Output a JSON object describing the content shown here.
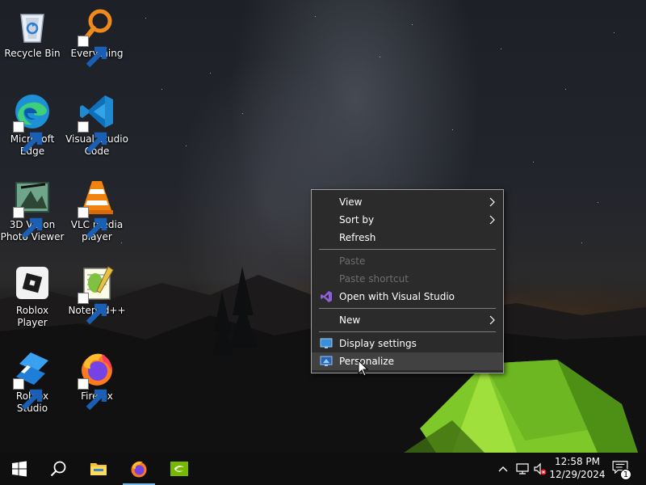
{
  "desktop": {
    "icons": [
      {
        "label": "Recycle Bin",
        "icon": "recycle-bin-icon"
      },
      {
        "label": "Everything",
        "icon": "everything-search-icon"
      },
      {
        "label": "Microsoft Edge",
        "icon": "edge-icon"
      },
      {
        "label": "Visual Studio Code",
        "icon": "vscode-icon"
      },
      {
        "label": "3D Vision Photo Viewer",
        "icon": "3d-vision-icon"
      },
      {
        "label": "VLC media player",
        "icon": "vlc-icon"
      },
      {
        "label": "Roblox Player",
        "icon": "roblox-player-icon"
      },
      {
        "label": "Notepad++",
        "icon": "notepad-plus-plus-icon"
      },
      {
        "label": "Roblox Studio",
        "icon": "roblox-studio-icon"
      },
      {
        "label": "Firefox",
        "icon": "firefox-icon"
      }
    ]
  },
  "context_menu": {
    "items": [
      {
        "label": "View",
        "submenu": true,
        "enabled": true
      },
      {
        "label": "Sort by",
        "submenu": true,
        "enabled": true
      },
      {
        "label": "Refresh",
        "enabled": true
      },
      {
        "label": "Paste",
        "enabled": false
      },
      {
        "label": "Paste shortcut",
        "enabled": false
      },
      {
        "label": "Open with Visual Studio",
        "enabled": true,
        "icon": "visual-studio-icon"
      },
      {
        "label": "New",
        "submenu": true,
        "enabled": true
      },
      {
        "label": "Display settings",
        "enabled": true,
        "icon": "display-settings-icon"
      },
      {
        "label": "Personalize",
        "enabled": true,
        "icon": "personalize-icon",
        "hovered": true
      }
    ]
  },
  "taskbar": {
    "buttons": [
      {
        "name": "start",
        "icon": "windows-logo-icon"
      },
      {
        "name": "search",
        "icon": "search-icon"
      },
      {
        "name": "file-explorer",
        "icon": "folder-icon"
      },
      {
        "name": "firefox",
        "icon": "firefox-icon",
        "active": true
      },
      {
        "name": "nvidia",
        "icon": "nvidia-icon"
      }
    ],
    "tray": {
      "icons": [
        "chevron-up-icon",
        "network-icon",
        "volume-muted-icon"
      ],
      "time": "12:58 PM",
      "date": "12/29/2024",
      "notification_count": "1"
    }
  },
  "colors": {
    "menu_bg": "#2b2b2b",
    "menu_hover": "#414141",
    "taskbar_bg": "#0f0f10",
    "accent": "#76b9ed"
  }
}
